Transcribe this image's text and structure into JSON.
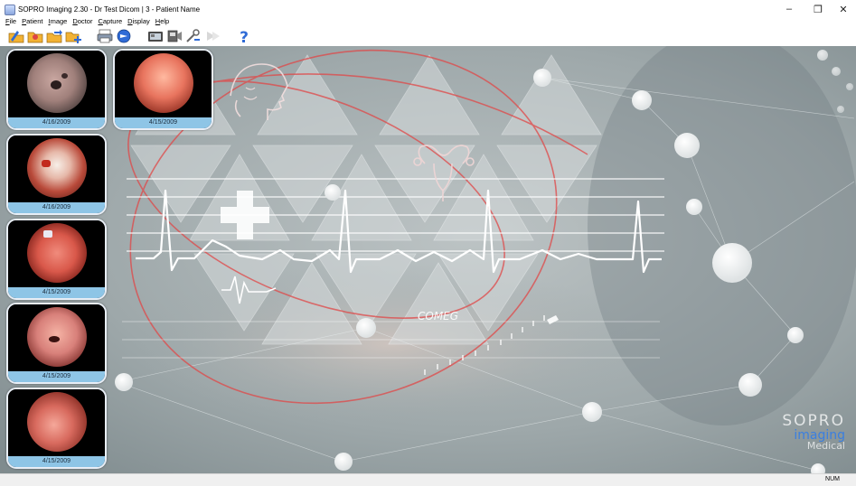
{
  "window": {
    "title": "SOPRO Imaging 2.30 - Dr Test Dicom | 3 - Patient Name",
    "minimize_glyph": "–",
    "maximize_glyph": "❐",
    "close_glyph": "✕"
  },
  "menu": [
    {
      "key": "F",
      "rest": "ile"
    },
    {
      "key": "P",
      "rest": "atient"
    },
    {
      "key": "I",
      "rest": "mage"
    },
    {
      "key": "D",
      "rest": "octor"
    },
    {
      "key": "C",
      "rest": "apture"
    },
    {
      "key": "D",
      "rest": "isplay"
    },
    {
      "key": "H",
      "rest": "elp"
    }
  ],
  "toolbar_icons": [
    "open-folder-icon",
    "patient-folder-icon",
    "folder-export-icon",
    "add-folder-icon",
    "print-icon",
    "send-icon",
    "capture-icon",
    "video-icon",
    "tools-icon",
    "forward-icon",
    "help-icon"
  ],
  "thumbnails": [
    {
      "date": "4/16/2009",
      "tone": "gray"
    },
    {
      "date": "4/15/2009",
      "tone": "orange"
    },
    {
      "date": "4/16/2009",
      "tone": "white"
    },
    {
      "date": "4/15/2009",
      "tone": "pink"
    },
    {
      "date": "4/15/2009",
      "tone": "pink2"
    },
    {
      "date": "4/15/2009",
      "tone": "pink3"
    }
  ],
  "background": {
    "comeg_label": "COMEG"
  },
  "brand": {
    "line1": "SOPRO",
    "line2": "imaging",
    "line3": "Medical"
  },
  "colors": {
    "accent_blue": "#3b7fe0",
    "date_bar": "#8ec5e6",
    "ecg_line": "#ffffff",
    "red_arc": "#e04848"
  },
  "status": {
    "num": "NUM"
  }
}
